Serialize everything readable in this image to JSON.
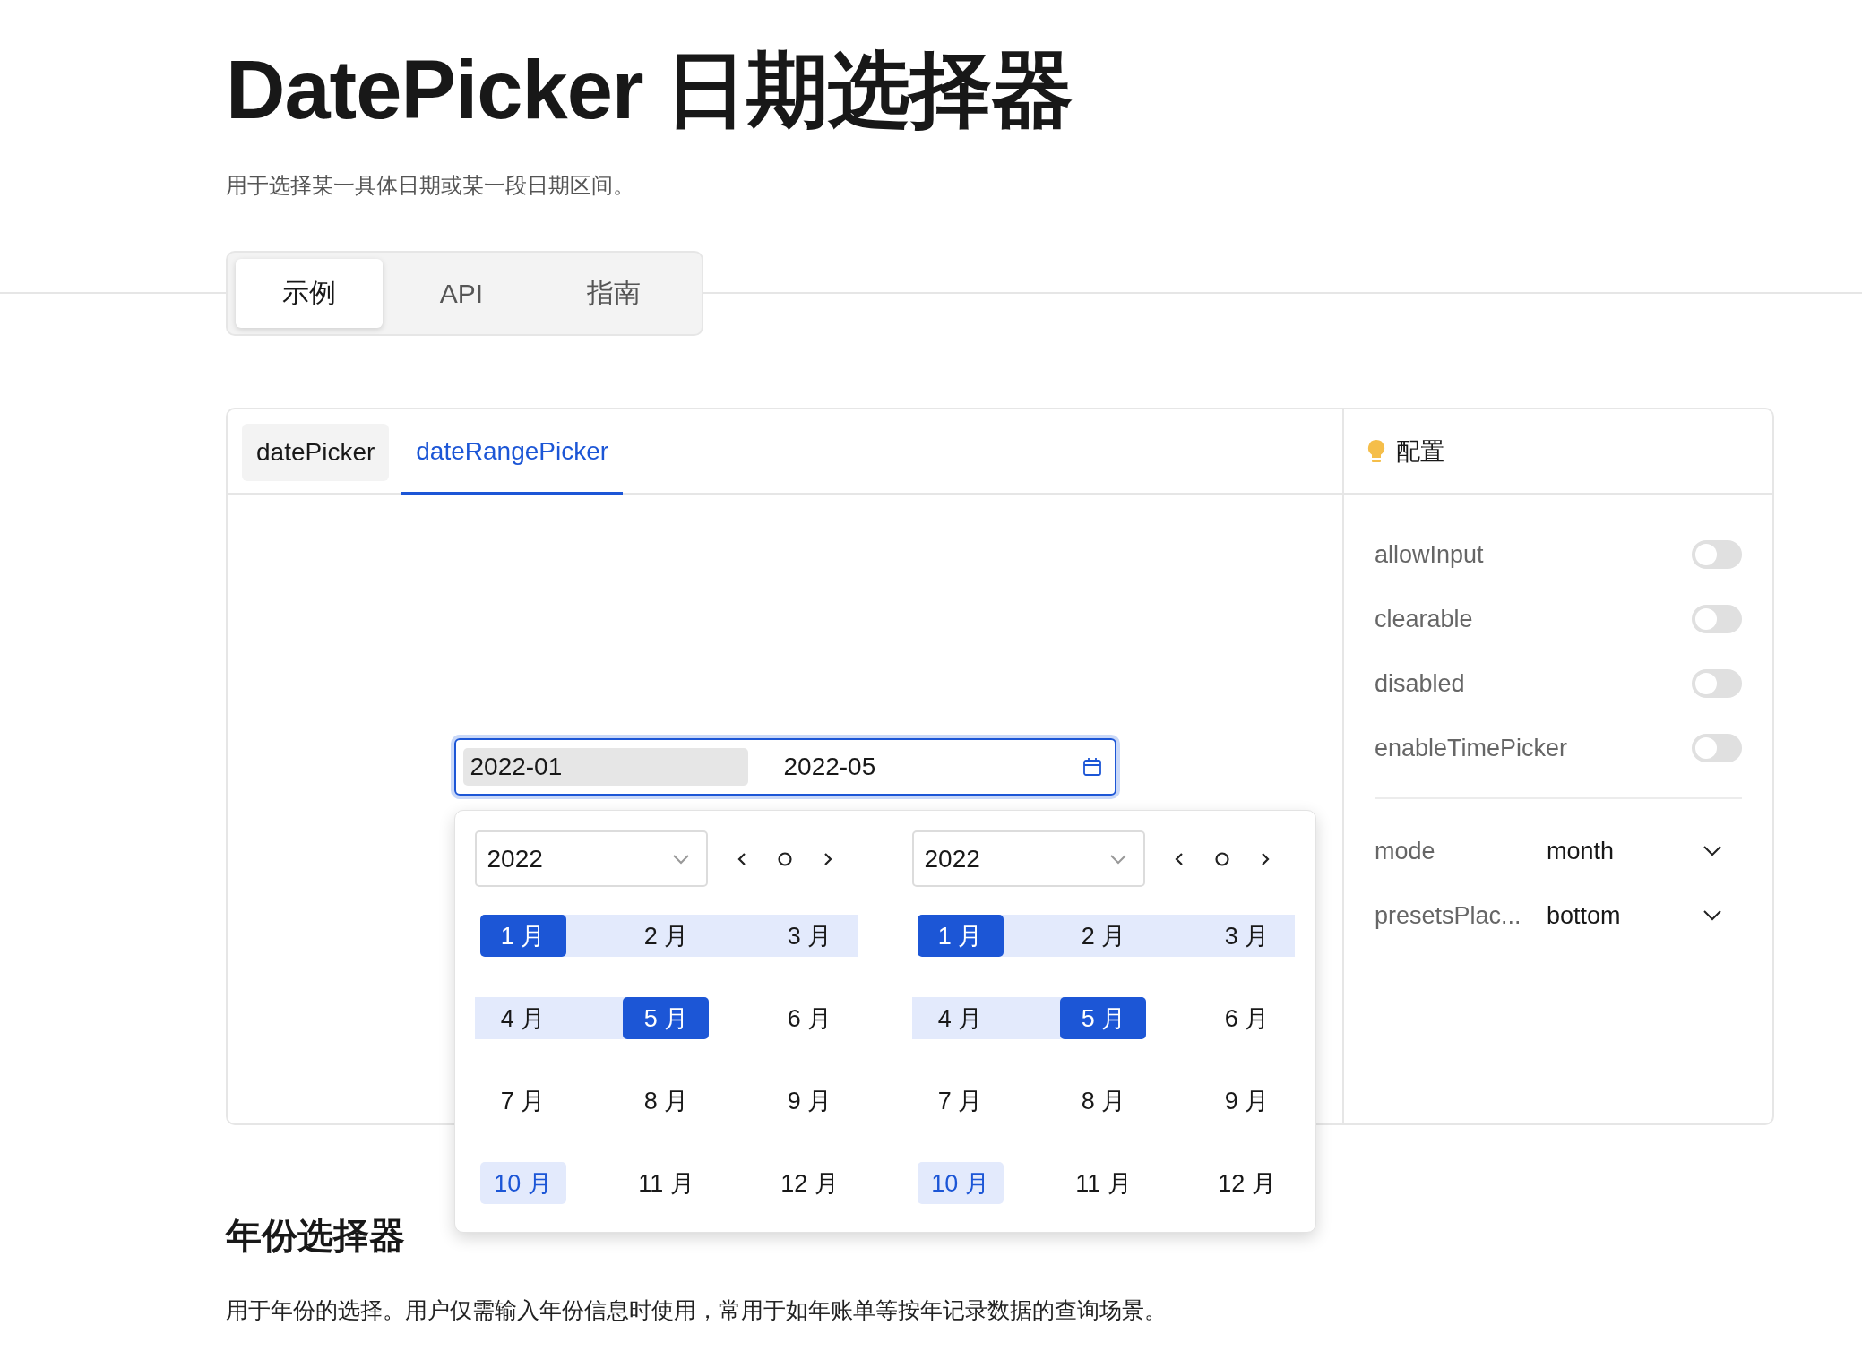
{
  "page": {
    "title": "DatePicker 日期选择器",
    "description": "用于选择某一具体日期或某一段日期区间。"
  },
  "doc_tabs": [
    {
      "label": "示例",
      "selected": true
    },
    {
      "label": "API",
      "selected": false
    },
    {
      "label": "指南",
      "selected": false
    }
  ],
  "demo": {
    "tabs": [
      {
        "label": "datePicker",
        "selected": false
      },
      {
        "label": "dateRangePicker",
        "selected": true
      }
    ],
    "range_input": {
      "focused": true,
      "parts": [
        {
          "value": "2022-01",
          "selected": true
        },
        {
          "value": "2022-05",
          "selected": false
        }
      ]
    },
    "panels": [
      {
        "year": "2022",
        "months": [
          {
            "label": "1 月",
            "selected": true,
            "in_range": false,
            "current": false
          },
          {
            "label": "2 月",
            "selected": false,
            "in_range": true,
            "current": false
          },
          {
            "label": "3 月",
            "selected": false,
            "in_range": true,
            "current": false
          },
          {
            "label": "4 月",
            "selected": false,
            "in_range": true,
            "current": false
          },
          {
            "label": "5 月",
            "selected": true,
            "in_range": false,
            "current": false
          },
          {
            "label": "6 月",
            "selected": false,
            "in_range": false,
            "current": false
          },
          {
            "label": "7 月",
            "selected": false,
            "in_range": false,
            "current": false
          },
          {
            "label": "8 月",
            "selected": false,
            "in_range": false,
            "current": false
          },
          {
            "label": "9 月",
            "selected": false,
            "in_range": false,
            "current": false
          },
          {
            "label": "10 月",
            "selected": false,
            "in_range": false,
            "current": true
          },
          {
            "label": "11 月",
            "selected": false,
            "in_range": false,
            "current": false
          },
          {
            "label": "12 月",
            "selected": false,
            "in_range": false,
            "current": false
          }
        ]
      },
      {
        "year": "2022",
        "months": [
          {
            "label": "1 月",
            "selected": true,
            "in_range": false,
            "current": false
          },
          {
            "label": "2 月",
            "selected": false,
            "in_range": true,
            "current": false
          },
          {
            "label": "3 月",
            "selected": false,
            "in_range": true,
            "current": false
          },
          {
            "label": "4 月",
            "selected": false,
            "in_range": true,
            "current": false
          },
          {
            "label": "5 月",
            "selected": true,
            "in_range": false,
            "current": false
          },
          {
            "label": "6 月",
            "selected": false,
            "in_range": false,
            "current": false
          },
          {
            "label": "7 月",
            "selected": false,
            "in_range": false,
            "current": false
          },
          {
            "label": "8 月",
            "selected": false,
            "in_range": false,
            "current": false
          },
          {
            "label": "9 月",
            "selected": false,
            "in_range": false,
            "current": false
          },
          {
            "label": "10 月",
            "selected": false,
            "in_range": false,
            "current": true
          },
          {
            "label": "11 月",
            "selected": false,
            "in_range": false,
            "current": false
          },
          {
            "label": "12 月",
            "selected": false,
            "in_range": false,
            "current": false
          }
        ]
      }
    ]
  },
  "config": {
    "title": "配置",
    "switches": [
      {
        "label": "allowInput",
        "on": false
      },
      {
        "label": "clearable",
        "on": false
      },
      {
        "label": "disabled",
        "on": false
      },
      {
        "label": "enableTimePicker",
        "on": false
      }
    ],
    "selects": [
      {
        "label": "mode",
        "value": "month"
      },
      {
        "label": "presetsPlac...",
        "value": "bottom"
      }
    ]
  },
  "section": {
    "title": "年份选择器",
    "description": "用于年份的选择。用户仅需输入年份信息时使用，常用于如年账单等按年记录数据的查询场景。"
  }
}
